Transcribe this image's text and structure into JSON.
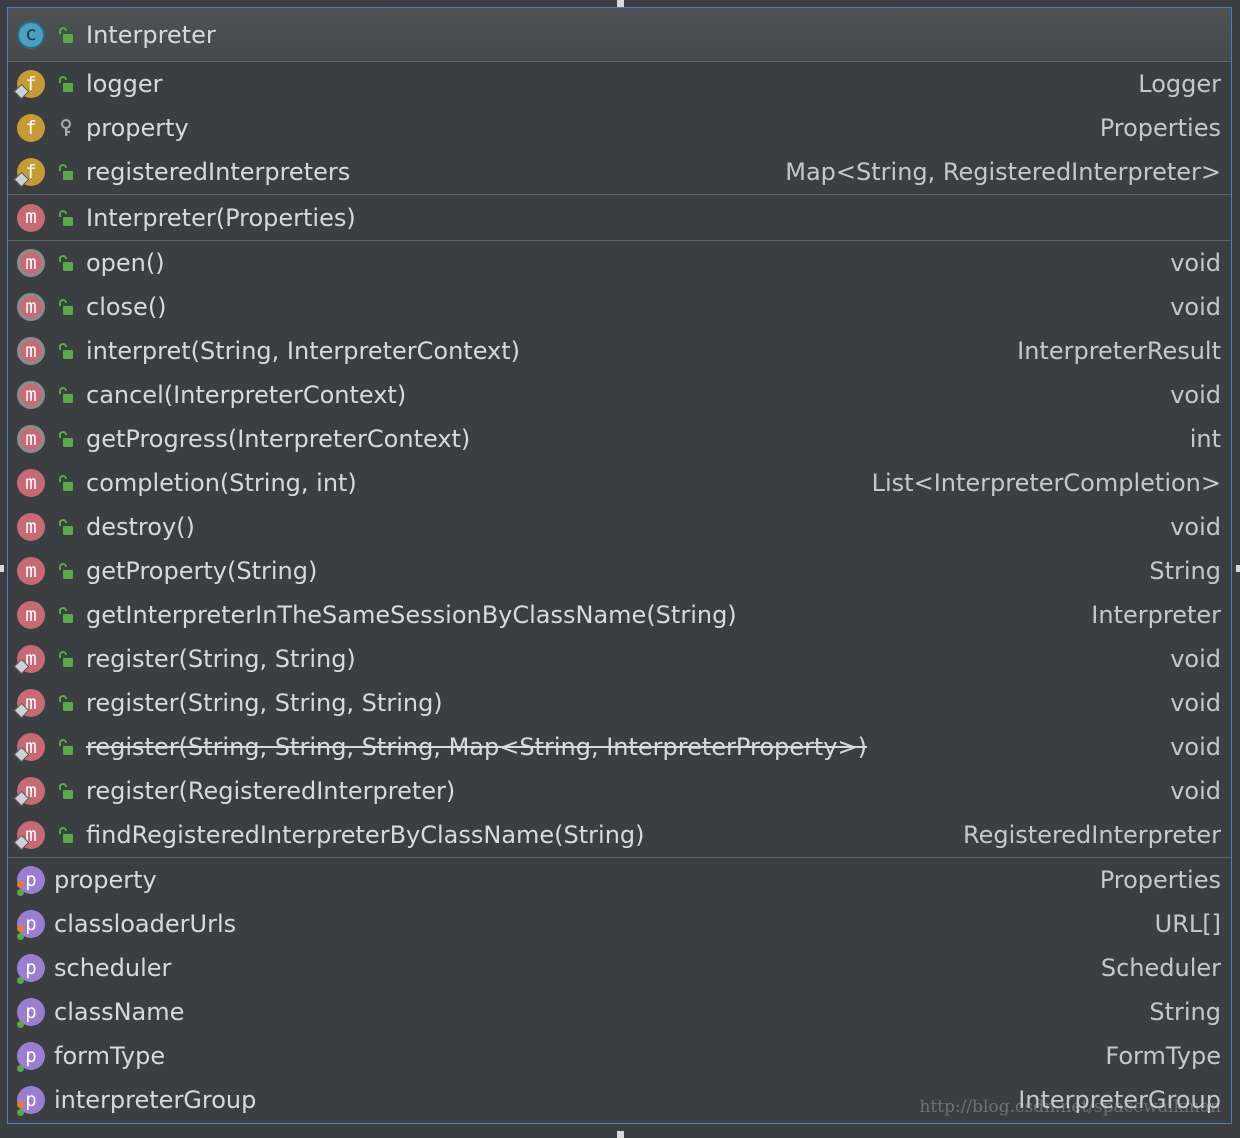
{
  "class": {
    "name": "Interpreter",
    "kind": "c"
  },
  "fields": [
    {
      "kind": "f",
      "name": "logger",
      "type": "Logger",
      "visibility": "public",
      "static": true
    },
    {
      "kind": "f",
      "name": "property",
      "type": "Properties",
      "visibility": "protected",
      "static": false
    },
    {
      "kind": "f",
      "name": "registeredInterpreters",
      "type": "Map<String, RegisteredInterpreter>",
      "visibility": "public",
      "static": true
    }
  ],
  "constructors": [
    {
      "kind": "m",
      "name": "Interpreter(Properties)",
      "type": "",
      "visibility": "public"
    }
  ],
  "methods": [
    {
      "kind": "m",
      "name": "open()",
      "type": "void",
      "abstract": true,
      "static": false,
      "deprecated": false
    },
    {
      "kind": "m",
      "name": "close()",
      "type": "void",
      "abstract": true,
      "static": false,
      "deprecated": false
    },
    {
      "kind": "m",
      "name": "interpret(String, InterpreterContext)",
      "type": "InterpreterResult",
      "abstract": true,
      "static": false,
      "deprecated": false
    },
    {
      "kind": "m",
      "name": "cancel(InterpreterContext)",
      "type": "void",
      "abstract": true,
      "static": false,
      "deprecated": false
    },
    {
      "kind": "m",
      "name": "getProgress(InterpreterContext)",
      "type": "int",
      "abstract": true,
      "static": false,
      "deprecated": false
    },
    {
      "kind": "m",
      "name": "completion(String, int)",
      "type": "List<InterpreterCompletion>",
      "abstract": false,
      "static": false,
      "deprecated": false
    },
    {
      "kind": "m",
      "name": "destroy()",
      "type": "void",
      "abstract": false,
      "static": false,
      "deprecated": false
    },
    {
      "kind": "m",
      "name": "getProperty(String)",
      "type": "String",
      "abstract": false,
      "static": false,
      "deprecated": false
    },
    {
      "kind": "m",
      "name": "getInterpreterInTheSameSessionByClassName(String)",
      "type": "Interpreter",
      "abstract": false,
      "static": false,
      "deprecated": false
    },
    {
      "kind": "m",
      "name": "register(String, String)",
      "type": "void",
      "abstract": false,
      "static": true,
      "deprecated": false
    },
    {
      "kind": "m",
      "name": "register(String, String, String)",
      "type": "void",
      "abstract": false,
      "static": true,
      "deprecated": false
    },
    {
      "kind": "m",
      "name": "register(String, String, String, Map<String, InterpreterProperty>)",
      "type": "void",
      "abstract": false,
      "static": true,
      "deprecated": true
    },
    {
      "kind": "m",
      "name": "register(RegisteredInterpreter)",
      "type": "void",
      "abstract": false,
      "static": true,
      "deprecated": false
    },
    {
      "kind": "m",
      "name": "findRegisteredInterpreterByClassName(String)",
      "type": "RegisteredInterpreter",
      "abstract": false,
      "static": true,
      "deprecated": false
    }
  ],
  "properties": [
    {
      "kind": "p",
      "name": "property",
      "type": "Properties",
      "getter": true,
      "setter": true
    },
    {
      "kind": "p",
      "name": "classloaderUrls",
      "type": "URL[]",
      "getter": true,
      "setter": true
    },
    {
      "kind": "p",
      "name": "scheduler",
      "type": "Scheduler",
      "getter": true,
      "setter": false
    },
    {
      "kind": "p",
      "name": "className",
      "type": "String",
      "getter": true,
      "setter": false
    },
    {
      "kind": "p",
      "name": "formType",
      "type": "FormType",
      "getter": true,
      "setter": false
    },
    {
      "kind": "p",
      "name": "interpreterGroup",
      "type": "InterpreterGroup",
      "getter": true,
      "setter": true
    }
  ],
  "watermark": "http://blog.csdn.net/spacewalkman",
  "colors": {
    "background": "#3c3f41",
    "border": "#4a7fc4",
    "text": "#d7dadc",
    "public_lock": "#5ba84a",
    "class_badge": "#4b9fbf",
    "field_badge": "#c69a36",
    "method_badge": "#c66b75",
    "property_badge": "#9a7fd0"
  }
}
